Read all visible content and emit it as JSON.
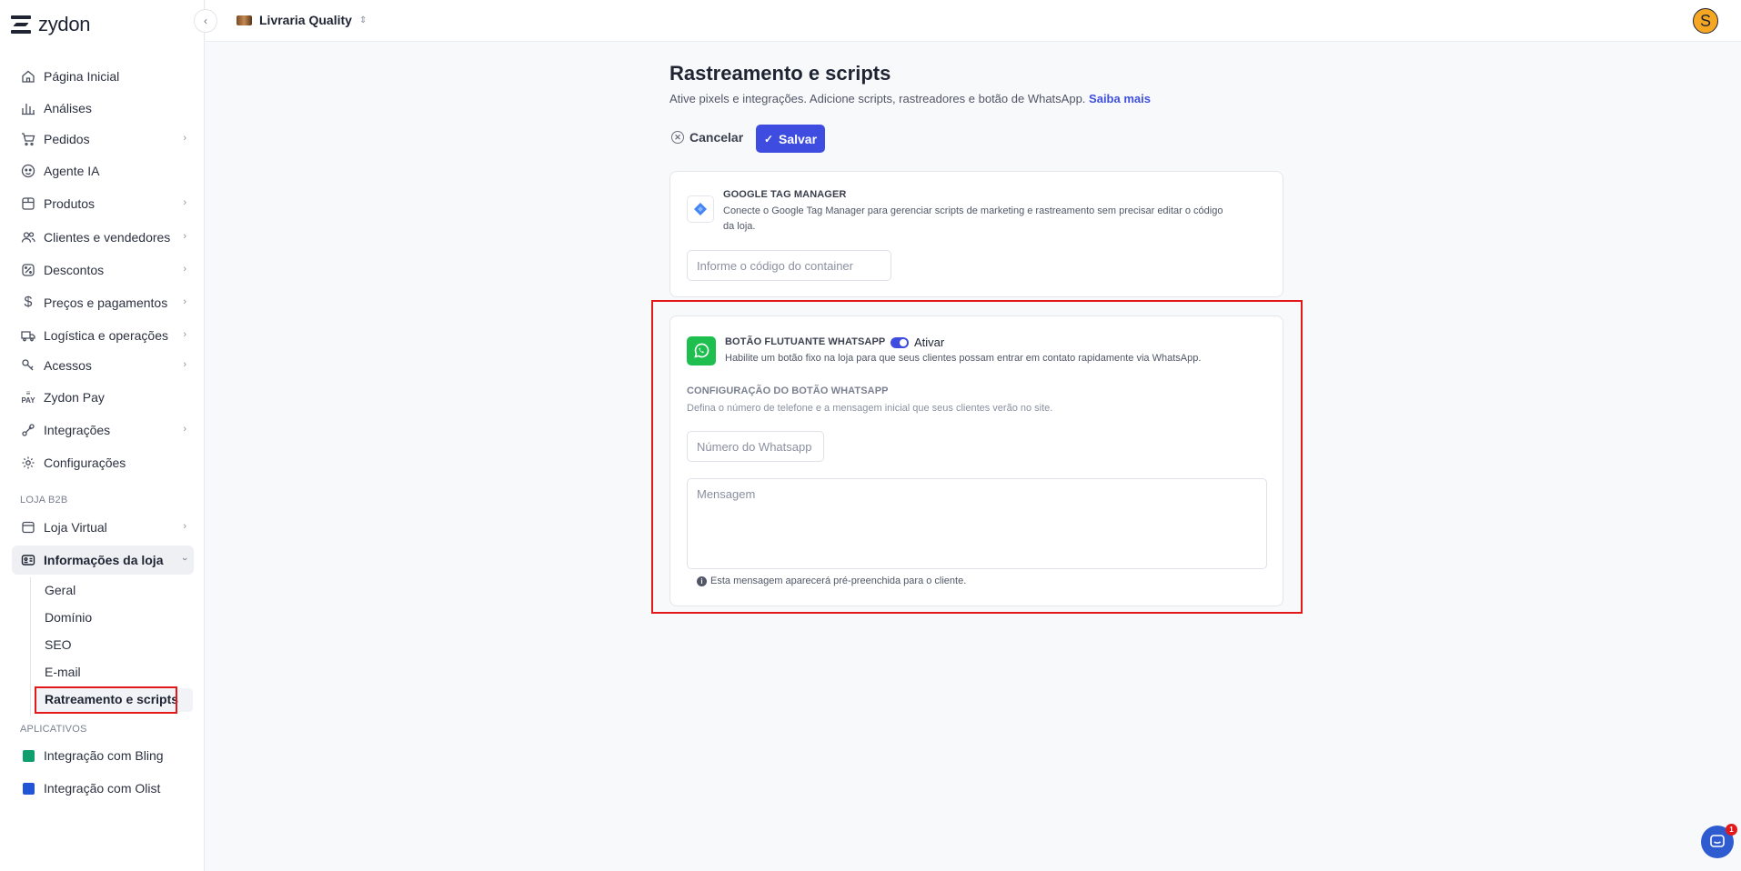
{
  "app": {
    "logo_text": "zydon"
  },
  "topbar": {
    "store_name": "Livraria Quality",
    "avatar_letter": "S"
  },
  "sidebar": {
    "items": [
      {
        "label": "Página Inicial",
        "icon": "home-icon"
      },
      {
        "label": "Análises",
        "icon": "chart-icon"
      },
      {
        "label": "Pedidos",
        "icon": "cart-icon"
      },
      {
        "label": "Agente IA",
        "icon": "bot-icon"
      },
      {
        "label": "Produtos",
        "icon": "box-icon"
      },
      {
        "label": "Clientes e vendedores",
        "icon": "users-icon"
      },
      {
        "label": "Descontos",
        "icon": "discount-icon"
      },
      {
        "label": "Preços e pagamentos",
        "icon": "dollar-icon"
      },
      {
        "label": "Logística e operações",
        "icon": "truck-icon"
      },
      {
        "label": "Acessos",
        "icon": "key-icon"
      },
      {
        "label": "Zydon Pay",
        "icon": "pay-icon"
      },
      {
        "label": "Integrações",
        "icon": "plug-icon"
      },
      {
        "label": "Configurações",
        "icon": "gear-icon"
      }
    ],
    "section_b2b": "LOJA B2B",
    "b2b_items": [
      {
        "label": "Loja Virtual",
        "icon": "store-icon"
      },
      {
        "label": "Informações da loja",
        "icon": "id-card-icon"
      }
    ],
    "sub_items": [
      "Geral",
      "Domínio",
      "SEO",
      "E-mail",
      "Ratreamento e scripts"
    ],
    "section_apps": "APLICATIVOS",
    "apps": [
      {
        "label": "Integração com Bling",
        "color": "#0f9e6e"
      },
      {
        "label": "Integração com Olist",
        "color": "#2255d6"
      }
    ]
  },
  "page": {
    "title": "Rastreamento e scripts",
    "subtitle": "Ative pixels e integrações. Adicione scripts, rastreadores e botão de WhatsApp.",
    "learn_more": "Saiba mais",
    "cancel_label": "Cancelar",
    "save_label": "Salvar"
  },
  "gtm": {
    "title": "GOOGLE TAG MANAGER",
    "desc_line1": "Conecte o Google Tag Manager para gerenciar scripts de marketing e rastreamento sem precisar editar o código",
    "desc_line2": "da loja.",
    "input_placeholder": "Informe o código do container"
  },
  "whatsapp": {
    "title": "BOTÃO FLUTUANTE WHATSAPP",
    "toggle_label": "Ativar",
    "toggle_on": true,
    "desc": "Habilite um botão fixo na loja para que seus clientes possam entrar em contato rapidamente via WhatsApp.",
    "config_title": "CONFIGURAÇÃO DO BOTÃO WHATSAPP",
    "config_desc": "Defina o número de telefone e a mensagem inicial que seus clientes verão no site.",
    "number_placeholder": "Número do Whatsapp",
    "message_placeholder": "Mensagem",
    "helper": "Esta mensagem aparecerá pré-preenchida para o cliente."
  },
  "chat": {
    "badge": "1"
  }
}
